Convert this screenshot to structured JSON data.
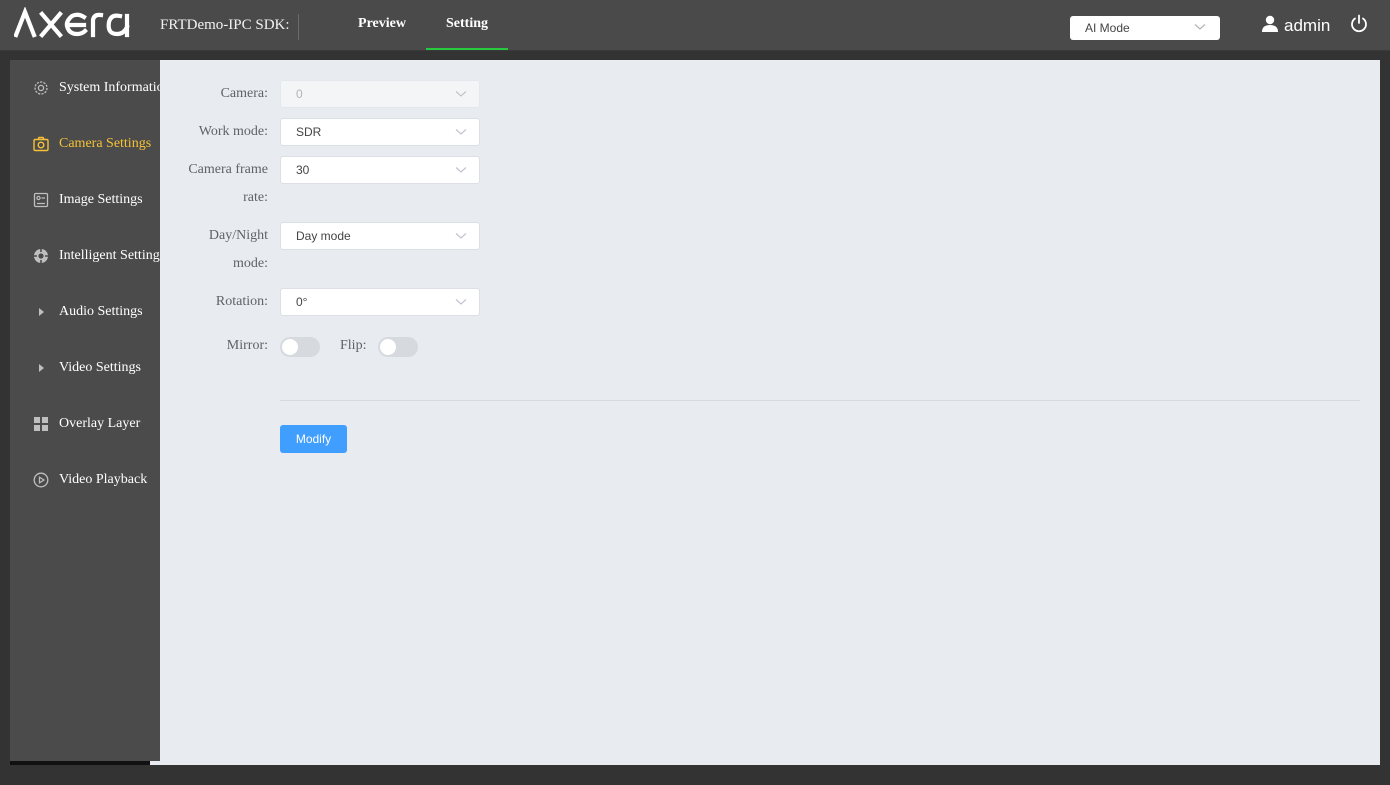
{
  "header": {
    "logo_text": "AXERA",
    "product": "FRTDemo-IPC SDK:",
    "tabs": [
      {
        "label": "Preview",
        "active": false
      },
      {
        "label": "Setting",
        "active": true
      }
    ],
    "mode_select": "AI Mode",
    "username": "admin",
    "accent_color": "#27c93f"
  },
  "sidebar": {
    "active_color": "#f5c136",
    "items": [
      {
        "label": "System Information",
        "icon": "gear-icon"
      },
      {
        "label": "Camera Settings",
        "icon": "camera-icon",
        "active": true
      },
      {
        "label": "Image Settings",
        "icon": "image-settings-icon"
      },
      {
        "label": "Intelligent Settings",
        "icon": "intelligent-icon"
      },
      {
        "label": "Audio Settings",
        "icon": "caret-right-icon"
      },
      {
        "label": "Video Settings",
        "icon": "caret-right-icon"
      },
      {
        "label": "Overlay Layer",
        "icon": "grid-icon"
      },
      {
        "label": "Video Playback",
        "icon": "play-circle-icon"
      }
    ]
  },
  "form": {
    "camera": {
      "label": "Camera:",
      "value": "0"
    },
    "work_mode": {
      "label": "Work mode:",
      "value": "SDR"
    },
    "frame_rate": {
      "label_line1": "Camera frame",
      "label_line2": "rate:",
      "value": "30"
    },
    "day_night": {
      "label_line1": "Day/Night",
      "label_line2": "mode:",
      "value": "Day mode"
    },
    "rotation": {
      "label": "Rotation:",
      "value": "0°"
    },
    "mirror": {
      "label": "Mirror:",
      "on": false
    },
    "flip": {
      "label": "Flip:",
      "on": false
    },
    "modify_label": "Modify",
    "button_color": "#409eff"
  }
}
